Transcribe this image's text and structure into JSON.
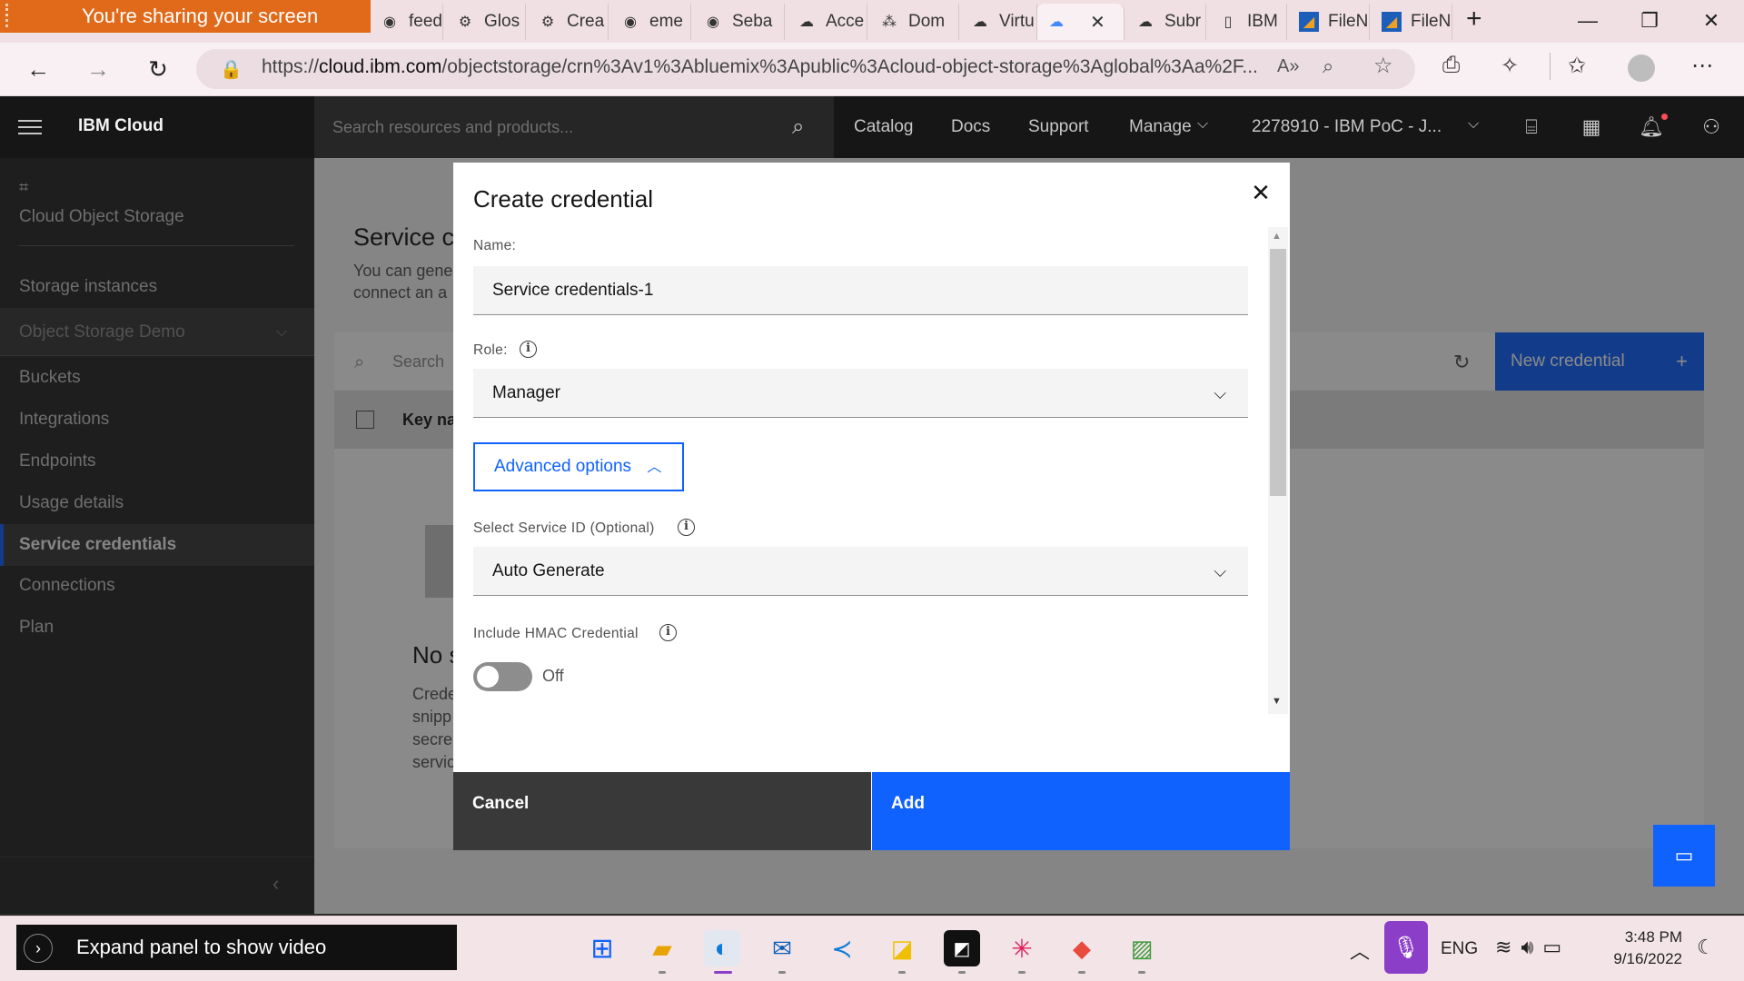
{
  "browser": {
    "sharing_banner": "You're sharing your screen",
    "tabs": [
      {
        "label": "feed",
        "icon": "github-icon"
      },
      {
        "label": "Glos",
        "icon": "gear-icon"
      },
      {
        "label": "Crea",
        "icon": "gear-icon"
      },
      {
        "label": "eme",
        "icon": "github-icon"
      },
      {
        "label": "Seba",
        "icon": "github-icon"
      },
      {
        "label": "Acce",
        "icon": "cloud-icon"
      },
      {
        "label": "Dom",
        "icon": "network-icon"
      },
      {
        "label": "Virtu",
        "icon": "cloud-icon"
      },
      {
        "label": "",
        "icon": "cloud-icon"
      },
      {
        "label": "Subr",
        "icon": "cloud-icon"
      },
      {
        "label": "IBM",
        "icon": "page-icon"
      },
      {
        "label": "FileN",
        "icon": "filenet-icon"
      },
      {
        "label": "FileN",
        "icon": "filenet-icon"
      }
    ],
    "url_prefix": "https://",
    "url_host": "cloud.ibm.com",
    "url_path": "/objectstorage/crn%3Av1%3Abluemix%3Apublic%3Acloud-object-storage%3Aglobal%3Aa%2F..."
  },
  "header": {
    "brand": "IBM Cloud",
    "search_placeholder": "Search resources and products...",
    "links": [
      "Catalog",
      "Docs",
      "Support",
      "Manage"
    ],
    "account": "2278910 - IBM PoC - J..."
  },
  "sidenav": {
    "title": "Cloud Object Storage",
    "storage_instances": "Storage instances",
    "instance_selected": "Object Storage  Demo",
    "items": [
      "Buckets",
      "Integrations",
      "Endpoints",
      "Usage details",
      "Service credentials",
      "Connections",
      "Plan"
    ],
    "active_index": 4
  },
  "main": {
    "title": "Service c",
    "desc_line1": "You can gene",
    "desc_line2": "connect an a",
    "search_placeholder": "Search",
    "new_credential": "New credential",
    "key_header": "Key na",
    "empty_title": "No s",
    "empty_lines": [
      "Crede",
      "snipp",
      "secre",
      "servic"
    ]
  },
  "modal": {
    "title": "Create credential",
    "name_label": "Name:",
    "name_value": "Service credentials-1",
    "role_label": "Role:",
    "role_value": "Manager",
    "advanced_label": "Advanced options",
    "service_id_label": "Select Service ID (Optional)",
    "service_id_value": "Auto Generate",
    "hmac_label": "Include HMAC Credential",
    "hmac_state": "Off",
    "cancel": "Cancel",
    "add": "Add"
  },
  "taskbar": {
    "video_panel": "Expand panel to show video",
    "language": "ENG",
    "time": "3:48 PM",
    "date": "9/16/2022"
  },
  "colors": {
    "primary_blue": "#0f62fe",
    "header_bg": "#161616",
    "sidenav_bg": "#262626",
    "sharing_banner": "#e06a1a"
  }
}
